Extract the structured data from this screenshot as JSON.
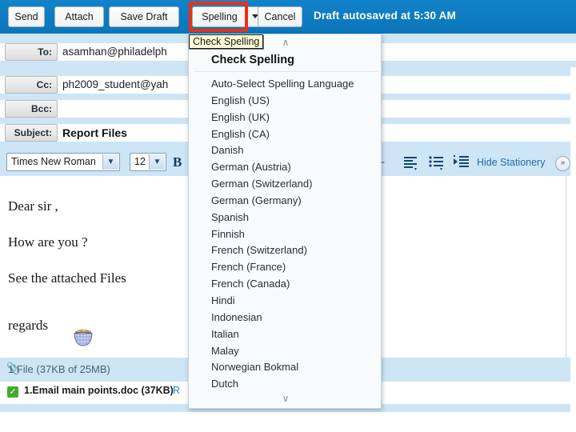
{
  "toolbar": {
    "send_label": "Send",
    "attach_label": "Attach",
    "save_draft_label": "Save Draft",
    "spelling_label": "Spelling",
    "cancel_label": "Cancel",
    "autosave_status": "Draft autosaved at 5:30 AM"
  },
  "tooltip": {
    "text": "Check Spelling"
  },
  "compose": {
    "to": {
      "label": "To:",
      "value": "asamhan@philadelph",
      "placeholder": ""
    },
    "cc": {
      "label": "Cc:",
      "value": "ph2009_student@yah",
      "placeholder": ""
    },
    "bcc": {
      "label": "Bcc:",
      "value": "",
      "placeholder": ""
    },
    "subject": {
      "label": "Subject:",
      "value": "Report Files",
      "placeholder": ""
    }
  },
  "format_toolbar": {
    "font_family": "Times New Roman",
    "font_size": "12",
    "bold_label": "B",
    "dash_label": "-",
    "hide_stationery_label": "Hide Stationery",
    "chevron_label": "»",
    "icons": {
      "font_dropdown": "chevron-down-icon",
      "size_dropdown": "chevron-down-icon",
      "align": "align-left-icon",
      "list": "bulleted-list-icon",
      "indent": "increase-indent-icon",
      "expand": "double-chevron-right-icon"
    }
  },
  "message_body": {
    "line1": "Dear sir ,",
    "line2": "How are you ?",
    "line3": "See the  attached Files",
    "line4": "regards",
    "emoticon_name": "basket-emoticon"
  },
  "attachments": {
    "summary": "1 File (37KB of 25MB)",
    "paperclip_icon": "paperclip-icon",
    "items": [
      {
        "name": "1.Email main points.doc (37KB)",
        "remove_label": "R",
        "status_icon": "green-check-icon"
      }
    ]
  },
  "spelling_menu": {
    "scroll_up_icon": "chevron-up-icon",
    "scroll_down_icon": "chevron-down-icon",
    "header": "Check Spelling",
    "items": [
      "Auto-Select Spelling Language",
      "English (US)",
      "English (UK)",
      "English (CA)",
      "Danish",
      "German (Austria)",
      "German (Switzerland)",
      "German (Germany)",
      "Spanish",
      "Finnish",
      "French (Switzerland)",
      "French (France)",
      "French (Canada)",
      "Hindi",
      "Indonesian",
      "Italian",
      "Malay",
      "Norwegian Bokmal",
      "Dutch"
    ]
  },
  "annotation": {
    "highlight_color": "#f02d12",
    "target": "Spelling"
  },
  "colors": {
    "header_blue": "#0e7ac0",
    "band_blue": "#cde5f5",
    "link_blue": "#1a6fae",
    "check_green": "#46aa32",
    "tooltip_bg": "#feffd8"
  }
}
